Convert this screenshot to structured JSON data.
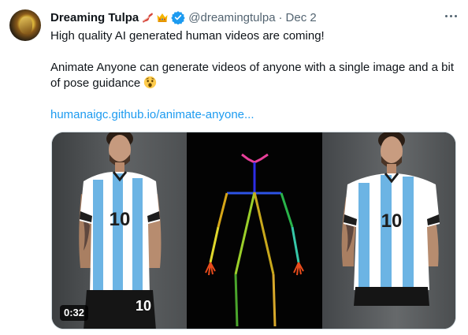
{
  "author": {
    "display_name": "Dreaming Tulpa",
    "handle": "@dreamingtulpa",
    "separator": "·",
    "date": "Dec 2",
    "emoji_badges": [
      "bacon-emoji",
      "crown-emoji"
    ],
    "verified_color": "#1d9bf0"
  },
  "tweet": {
    "line1": "High quality AI generated human videos are coming!",
    "line2": "Animate Anyone can generate videos of anyone with a single image and a bit of pose guidance",
    "line2_emoji": "astonished-face-emoji",
    "link": "humanaigc.github.io/animate-anyone..."
  },
  "media": {
    "duration": "0:32",
    "panels": [
      "reference-photo",
      "pose-skeleton",
      "generated-video-frame"
    ],
    "jersey_number_left": "10",
    "jersey_number_right": "10",
    "shorts_number": "10"
  },
  "colors": {
    "text": "#0f1419",
    "muted": "#536471",
    "link": "#1d9bf0",
    "border": "#cfd9de"
  }
}
